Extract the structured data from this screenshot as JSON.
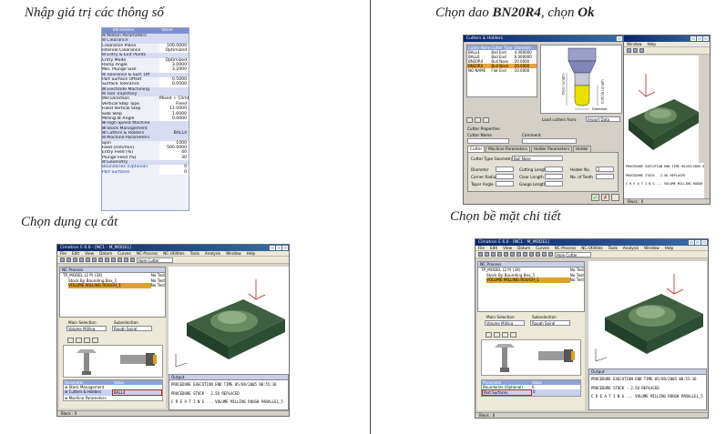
{
  "captions": {
    "enter_params": "Nhập giá trị các thông số",
    "choose_tool": "Chọn dụng cụ cắt",
    "choose_cutter_pre": "Chọn dao ",
    "choose_cutter_bold": "BN20R4",
    "choose_cutter_mid": ", chọn ",
    "choose_cutter_ok": "Ok",
    "choose_surface": "Chọn bề mặt chi tiết"
  },
  "param_table": {
    "headers": [
      "Parameter",
      "Value"
    ],
    "rows": [
      {
        "name": "⊟ Motion Parameters",
        "value": "",
        "section": true
      },
      {
        "name": "  ⊟ Clearance",
        "value": "",
        "section": true
      },
      {
        "name": "    Clearance Plane",
        "value": "100.0000"
      },
      {
        "name": "    Interval Clearance",
        "value": "Optimized"
      },
      {
        "name": "  ⊟ Entry & Exit Points",
        "value": "",
        "section": true
      },
      {
        "name": "    Entry Mode",
        "value": "Optimized"
      },
      {
        "name": "    Ramp Angle",
        "value": "3.0000"
      },
      {
        "name": "    Min. Plunge Size",
        "value": "3.2000"
      },
      {
        "name": "  ⊟ Tolerance & Surf. Off",
        "value": "",
        "section": true
      },
      {
        "name": "    Part Surface Offset",
        "value": "0.5000"
      },
      {
        "name": "    Surface Tolerance",
        "value": "0.0500"
      },
      {
        "name": "  ⊞ Electrode Machining",
        "value": "",
        "section": true
      },
      {
        "name": "  ⊟ Tool Trajectory",
        "value": "",
        "section": true
      },
      {
        "name": "    Mill Direction",
        "value": "Mixed + Climb Fi"
      },
      {
        "name": "    Vertical Step Type",
        "value": "Fixed"
      },
      {
        "name": "    Fixed Vertical Step",
        "value": "11.0000"
      },
      {
        "name": "    Side Step",
        "value": "1.6000"
      },
      {
        "name": "    Milling at Angle",
        "value": "0.0000"
      },
      {
        "name": "  ⊞ High Speed Machine",
        "value": "",
        "section": true
      },
      {
        "name": "  ⊞ Stock Management",
        "value": "",
        "section": true
      },
      {
        "name": "⊞ Cutters & Holders",
        "value": "BALL4",
        "section": true
      },
      {
        "name": "⊟ Machine Parameters",
        "value": "",
        "section": true
      },
      {
        "name": "    Spin",
        "value": "1000"
      },
      {
        "name": "    Feed (mm/min)",
        "value": "500.0000"
      },
      {
        "name": "    Entry Feed (%)",
        "value": "40"
      },
      {
        "name": "    Plunge Feed (%)",
        "value": "30"
      },
      {
        "name": "⊟ Geometry",
        "value": "",
        "section": true
      },
      {
        "name": "    Boundaries (Optional)",
        "value": "0",
        "hl": true
      },
      {
        "name": "    Part Surfaces",
        "value": "0",
        "hl": true
      }
    ]
  },
  "cutters_dialog": {
    "title": "Cutters & Holders",
    "columns": [
      "Cutter Name",
      "Cutter Type",
      "Diameter"
    ],
    "rows": [
      [
        "BALL4",
        "Ball End",
        "4.000000"
      ],
      [
        "BALL6",
        "Ball End",
        "6.000000"
      ],
      [
        "BN20R4",
        "Bull Nose",
        "20.0000"
      ],
      [
        "BN20R4",
        "Bull Nose",
        "20.0000"
      ],
      [
        "NO NAME",
        "Flat End",
        "10.0000"
      ]
    ],
    "selected_row": 3,
    "load_label": "Load cutters from:",
    "load_value": "Import Data",
    "properties_label": "Cutter Properties",
    "cutter_name_label": "Cutter Name",
    "comment_label": "Comment",
    "tabs": [
      "Cutter",
      "Machine Parameters",
      "Holder Parameters",
      "Holder"
    ],
    "type_label": "Cutter Type Geometry",
    "type_value": "Bull Nose",
    "fields": {
      "diameter": "Diameter",
      "corner_radius": "Corner Radius",
      "taper_angle": "Taper Angle",
      "cutting_length": "Cutting Length",
      "clear_length": "Clear Length",
      "gauge_length": "Gauge Length",
      "holder_no": "Holder No.",
      "holder_no_value": "2",
      "no_teeth": "No. of Teeth"
    },
    "dim_labels": [
      "Clear Length",
      "Cutting Length",
      "Diameter"
    ]
  },
  "app": {
    "title": "Cimatron E 6.0 - [NC1 - M_MODEL]",
    "menus": [
      "File",
      "Edit",
      "View",
      "Datum",
      "Curves",
      "NC-Process",
      "NC-Utilities",
      "Tools",
      "Analysis",
      "Window",
      "Help"
    ],
    "combo": "Hole Cutter",
    "nc_process_title": "NC Process",
    "tree": [
      "TP_MODEL (2 P) (3X)",
      "Stock By Bounding Box_1",
      "VOLUME MILLING ROUGH_1"
    ],
    "tree_status": [
      "No Test",
      "No Test",
      "No Test"
    ],
    "main_selection_label": "Main Selection",
    "main_selection_value": "Volume Milling",
    "sub_selection_label": "Subselection",
    "sub_selection_value": "Rough Spiral",
    "output_title": "Output",
    "output_lines": [
      "PROCEDURE EXECUTION END TIME   05/09/2005 08:55:36",
      "PROCEDURE STOCK  - 2.5D REPLACED",
      "C R E A T I N G ...  VOLUME MILLING ROUGH PARALLEL_5"
    ],
    "status": "Block : 0",
    "left_grid_headers": [
      "Parameter",
      "Value"
    ],
    "left_grid_rows": [
      [
        "⊞ Stock Management",
        ""
      ],
      [
        "⊞ Cutters & Holders",
        "BALL4"
      ],
      [
        "⊞ Machine Parameters",
        ""
      ]
    ],
    "right_grid_rows": [
      [
        "Boundaries (Optional)",
        "0"
      ],
      [
        "Part Surfaces",
        "0"
      ]
    ]
  }
}
